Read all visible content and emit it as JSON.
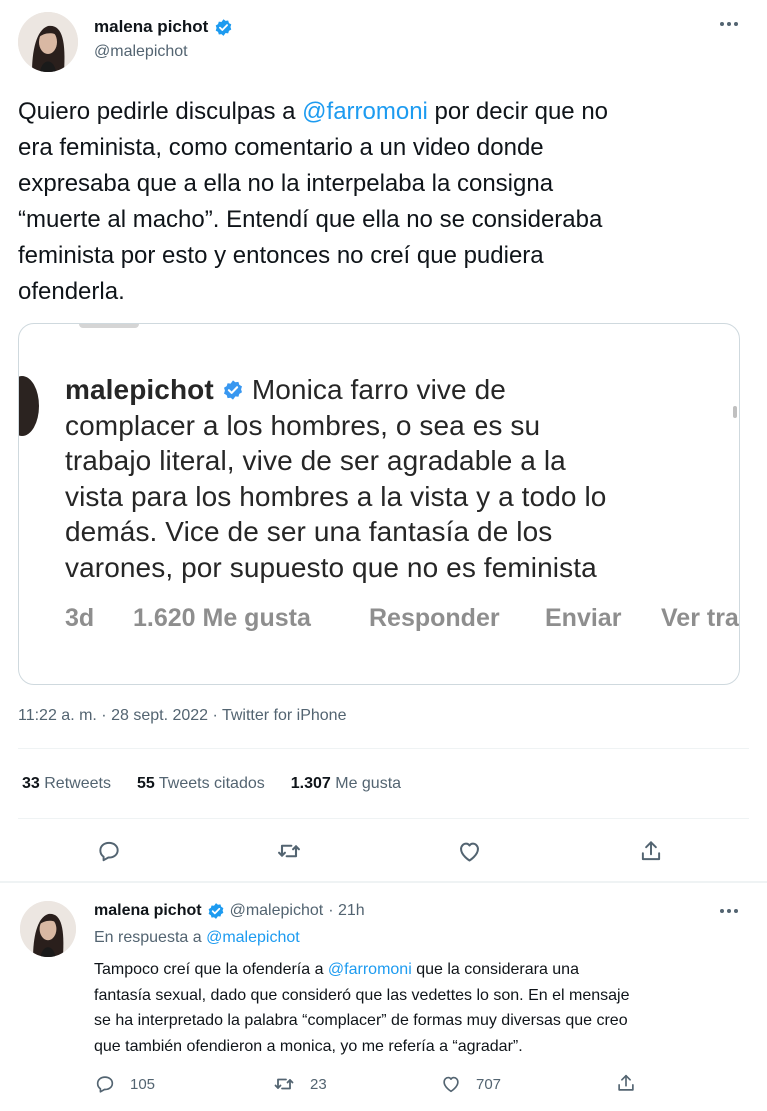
{
  "main_tweet": {
    "author_name": "malena pichot",
    "author_handle": "@malepichot",
    "more_icon": "more-icon",
    "text_lines": [
      [
        "Quiero pedirle disculpas a ",
        "@farromoni",
        " por decir que no"
      ],
      [
        "era feminista, como comentario a un video donde"
      ],
      [
        "expresaba que a ella no la interpelaba la consigna"
      ],
      [
        "“muerte al macho”. Entendí que ella no se consideraba"
      ],
      [
        "feminista por esto y entonces no creí que pudiera"
      ],
      [
        "ofenderla."
      ]
    ],
    "quoted": {
      "username": "malepichot",
      "lines": [
        "Monica farro vive de",
        "complacer a los hombres, o sea es su",
        "trabajo literal, vive de ser agradable a la",
        "vista para los hombres a la vista y a todo lo",
        "demás. Vice de ser una fantasía de los",
        "varones, por supuesto que no es feminista"
      ],
      "meta_time": "3d",
      "meta_likes": "1.620 Me gusta",
      "meta_reply": "Responder",
      "meta_send": "Enviar",
      "meta_more": "Ver tra"
    },
    "timestamp": "11:22 a. m. · 28 sept. 2022 · Twitter for iPhone",
    "stats": {
      "retweets_num": "33",
      "retweets_label": "Retweets",
      "quotes_num": "55",
      "quotes_label": "Tweets citados",
      "likes_num": "1.307",
      "likes_label": "Me gusta"
    }
  },
  "reply_tweet": {
    "author_name": "malena pichot",
    "author_handle": "@malepichot",
    "time": "· 21h",
    "replying_to_label": "En respuesta a",
    "replying_to_handle": "@malepichot",
    "text_lines": [
      [
        "Tampoco creí que la ofendería a ",
        "@farromoni",
        " que la considerara una"
      ],
      [
        "fantasía sexual, dado que consideró que las vedettes lo son. En el mensaje"
      ],
      [
        "se ha interpretado la palabra “complacer” de formas muy diversas que creo"
      ],
      [
        "que también ofendieron a monica, yo me refería a “agradar”."
      ]
    ],
    "replies": "105",
    "retweets": "23",
    "likes": "707"
  },
  "colors": {
    "accent": "#1d9bf0",
    "text": "#0f1419",
    "muted": "#536471",
    "border": "#cfd9de"
  }
}
